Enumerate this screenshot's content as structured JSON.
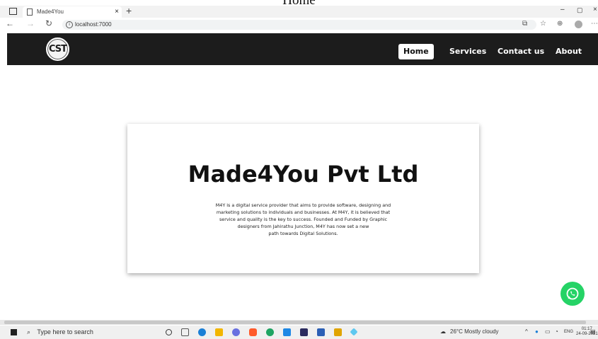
{
  "caption": "Home",
  "browser": {
    "tab_title": "Made4You",
    "tab_close": "×",
    "new_tab": "+",
    "url": "localhost:7000",
    "window_min": "–",
    "window_max": "▢",
    "window_close": "×"
  },
  "site": {
    "logo_text": "CST",
    "nav": [
      {
        "label": "Home",
        "active": true
      },
      {
        "label": "Services",
        "active": false
      },
      {
        "label": "Contact us",
        "active": false
      },
      {
        "label": "About",
        "active": false
      }
    ]
  },
  "card": {
    "title": "Made4You Pvt Ltd",
    "lines": [
      "M4Y is a digital service provider that aims to provide software, designing and",
      "marketing solutions to individuals and businesses. At M4Y, it is believed that",
      "service and quality is the key to success. Founded and Funded by Graphic",
      "designers from Jahirathu Junction, M4Y has now set a new",
      "path towards Digital Solutions."
    ]
  },
  "taskbar": {
    "search_placeholder": "Type here to search",
    "weather": "26°C  Mostly cloudy",
    "lang": "ENG",
    "time": "01:17",
    "date": "24-09-2021"
  },
  "colors": {
    "header_bg": "#1c1c1c",
    "whatsapp": "#25d366"
  }
}
